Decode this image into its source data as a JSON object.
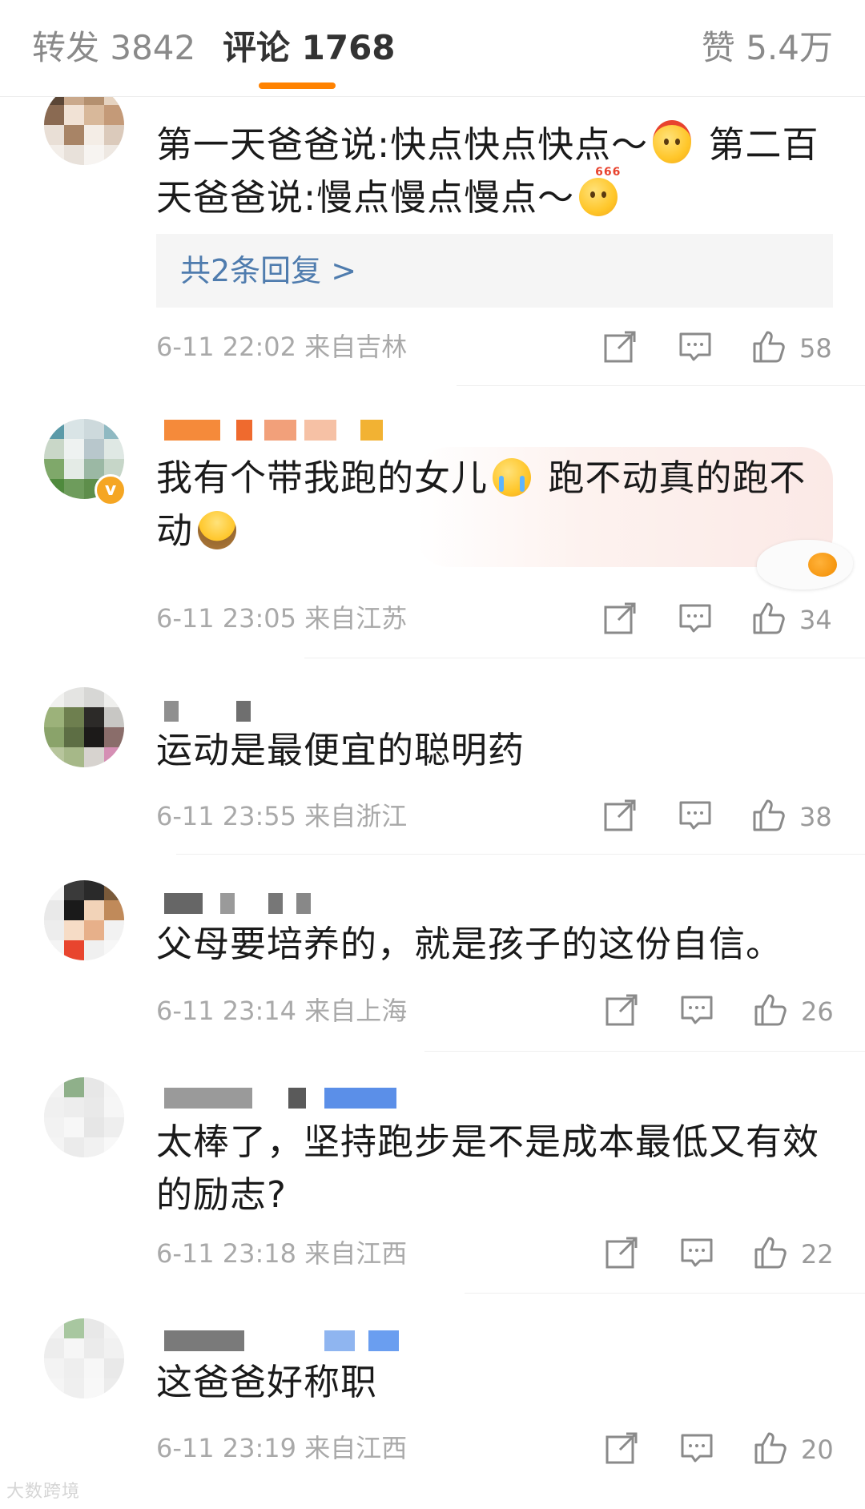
{
  "tabs": {
    "repost": "转发 3842",
    "comments": "评论 1768",
    "likes": "赞 5.4万"
  },
  "comments": [
    {
      "text_a": "第一天爸爸说:快点快点快点～",
      "emoji_a": "grinning-headband-emoji",
      "text_b": " 第二百天爸爸说:慢点慢点慢点～",
      "emoji_b": "666-thumbs-emoji",
      "replies": "共2条回复 >",
      "meta": "6-11 22:02 来自吉林",
      "likes": "58"
    },
    {
      "text_a": "我有个带我跑的女儿",
      "emoji_a": "crying-emoji",
      "text_b": " 跑不动真的跑不动",
      "emoji_b": "kneeling-emoji",
      "meta": "6-11 23:05 来自江苏",
      "likes": "34"
    },
    {
      "text": "运动是最便宜的聪明药",
      "meta": "6-11 23:55 来自浙江",
      "likes": "38"
    },
    {
      "text": "父母要培养的，就是孩子的这份自信。",
      "meta": "6-11 23:14 来自上海",
      "likes": "26"
    },
    {
      "text": "太棒了，坚持跑步是不是成本最低又有效的励志?",
      "meta": "6-11 23:18 来自江西",
      "likes": "22"
    },
    {
      "text": "这爸爸好称职",
      "meta": "6-11 23:19 来自江西",
      "likes": "20"
    }
  ],
  "watermark": "大数跨境",
  "colors": {
    "accent": "#ff8200",
    "reply_link": "#4f7cae",
    "meta_text": "#a9a9a9",
    "body_text": "#1a1a1a",
    "reply_box_bg": "#f5f5f5"
  }
}
